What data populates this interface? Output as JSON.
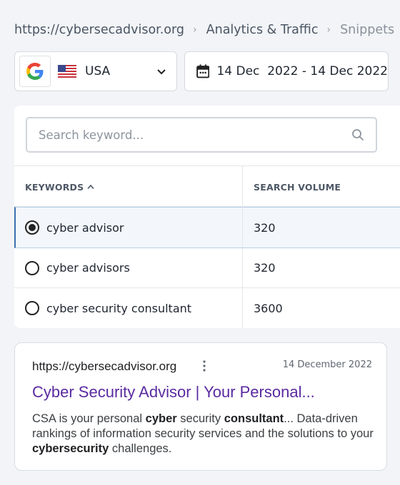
{
  "breadcrumb": {
    "items": [
      "https://cybersecadvisor.org",
      "Analytics & Traffic",
      "Snippets"
    ]
  },
  "engine": {
    "icon": "google-g-icon",
    "country": "USA",
    "flag": "usa-flag-icon"
  },
  "date_range": {
    "icon": "calendar-icon",
    "text": "14 Dec  2022 - 14 Dec 2022"
  },
  "search": {
    "placeholder": "Search keyword...",
    "value": ""
  },
  "table": {
    "headers": {
      "keywords": "KEYWORDS",
      "search_volume": "SEARCH VOLUME"
    },
    "sort": "ascending",
    "rows": [
      {
        "keyword": "cyber advisor",
        "volume": "320",
        "selected": true
      },
      {
        "keyword": "cyber advisors",
        "volume": "320",
        "selected": false
      },
      {
        "keyword": "cyber security consultant",
        "volume": "3600",
        "selected": false
      }
    ]
  },
  "snippet": {
    "url": "https://cybersecadvisor.org",
    "date": "14 December 2022",
    "title": "Cyber Security Advisor | Your Personal...",
    "desc": {
      "t1": "CSA is your personal ",
      "b1": "cyber",
      "t2": " security ",
      "b2": "consultant",
      "t3": "... Data-driven rankings of information security services and the solutions to your ",
      "b3": "cybersecurity",
      "t4": " challenges."
    }
  },
  "colors": {
    "accent": "#3d6fad",
    "link": "#5a2aa0",
    "background": "#f2f4f7"
  }
}
